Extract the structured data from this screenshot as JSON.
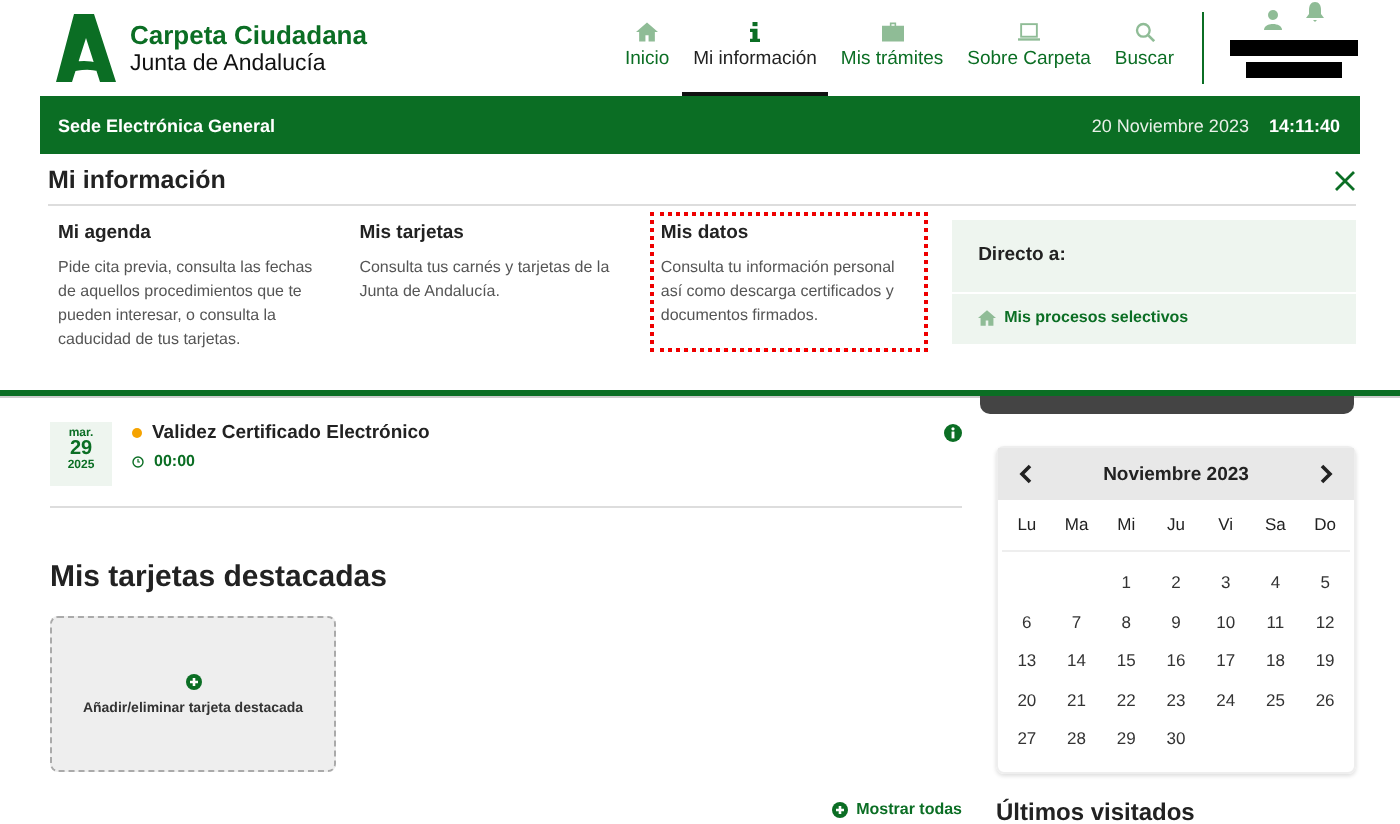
{
  "brand": {
    "title": "Carpeta Ciudadana",
    "subtitle": "Junta de Andalucía"
  },
  "nav": [
    {
      "label": "Inicio",
      "selected": false
    },
    {
      "label": "Mi información",
      "selected": true
    },
    {
      "label": "Mis trámites",
      "selected": false
    },
    {
      "label": "Sobre Carpeta",
      "selected": false
    },
    {
      "label": "Buscar",
      "selected": false
    }
  ],
  "sede_bar": {
    "title": "Sede Electrónica General",
    "date": "20 Noviembre 2023",
    "time": "14:11:40"
  },
  "panel": {
    "title": "Mi información",
    "sections": [
      {
        "title": "Mi agenda",
        "description": "Pide cita previa, consulta las fechas de aquellos procedimientos que te pueden interesar, o consulta la caducidad de tus tarjetas.",
        "focused": false
      },
      {
        "title": "Mis tarjetas",
        "description": "Consulta tus carnés y tarjetas de la Junta de Andalucía.",
        "focused": false
      },
      {
        "title": "Mis datos",
        "description": "Consulta tu información personal así como descarga certificados y documentos firmados.",
        "focused": true
      }
    ],
    "direct": {
      "title": "Directo a:",
      "links": [
        "Mis procesos selectivos"
      ]
    }
  },
  "event": {
    "weekday": "mar.",
    "day": "29",
    "year": "2025",
    "title": "Validez Certificado Electrónico",
    "time": "00:00",
    "color": "#f5a300"
  },
  "cards": {
    "title": "Mis tarjetas destacadas",
    "add_label": "Añadir/eliminar tarjeta destacada",
    "show_all": "Mostrar todas"
  },
  "calendar": {
    "title": "Noviembre 2023",
    "weekdays": [
      "Lu",
      "Ma",
      "Mi",
      "Ju",
      "Vi",
      "Sa",
      "Do"
    ],
    "weeks": [
      [
        "1",
        "2",
        "3",
        "4",
        "5"
      ],
      [
        "6",
        "7",
        "8",
        "9",
        "10",
        "11",
        "12"
      ],
      [
        "13",
        "14",
        "15",
        "16",
        "17",
        "18",
        "19"
      ],
      [
        "20",
        "21",
        "22",
        "23",
        "24",
        "25",
        "26"
      ],
      [
        "27",
        "28",
        "29",
        "30"
      ]
    ]
  },
  "recent": {
    "title": "Últimos visitados"
  }
}
